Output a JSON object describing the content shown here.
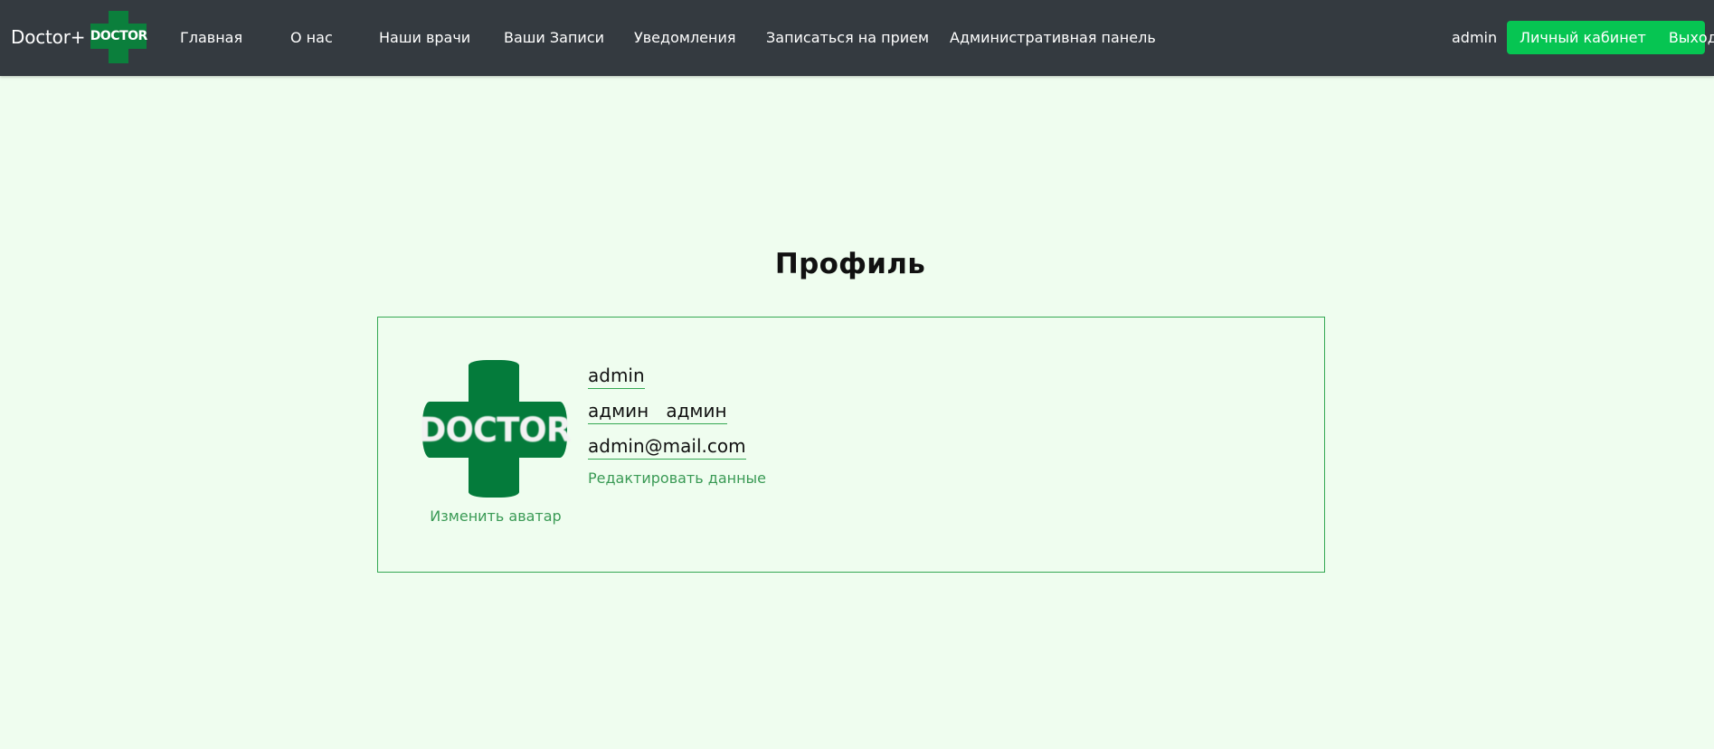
{
  "navbar": {
    "brand": "Doctor+",
    "logo_text": "DOCTOR",
    "items": [
      {
        "label": "Главная"
      },
      {
        "label": "О нас"
      },
      {
        "label": "Наши врачи"
      },
      {
        "label": "Ваши Записи"
      },
      {
        "label": "Уведомления"
      },
      {
        "label": "Записаться на прием"
      },
      {
        "label": "Административная панель"
      }
    ],
    "username": "admin",
    "cabinet_button": "Личный кабинет",
    "logout_button": "Выход"
  },
  "profile": {
    "title": "Профиль",
    "avatar_text": "DOCTOR",
    "change_avatar": "Изменить аватар",
    "login": "admin",
    "full_name": "админ   админ",
    "email": "admin@mail.com",
    "edit_link": "Редактировать данные"
  },
  "colors": {
    "navbar_bg": "#343a40",
    "page_bg": "#effdef",
    "accent_green": "#06c552",
    "logo_green": "#0b7f3c",
    "link_green": "#3a9a55"
  }
}
